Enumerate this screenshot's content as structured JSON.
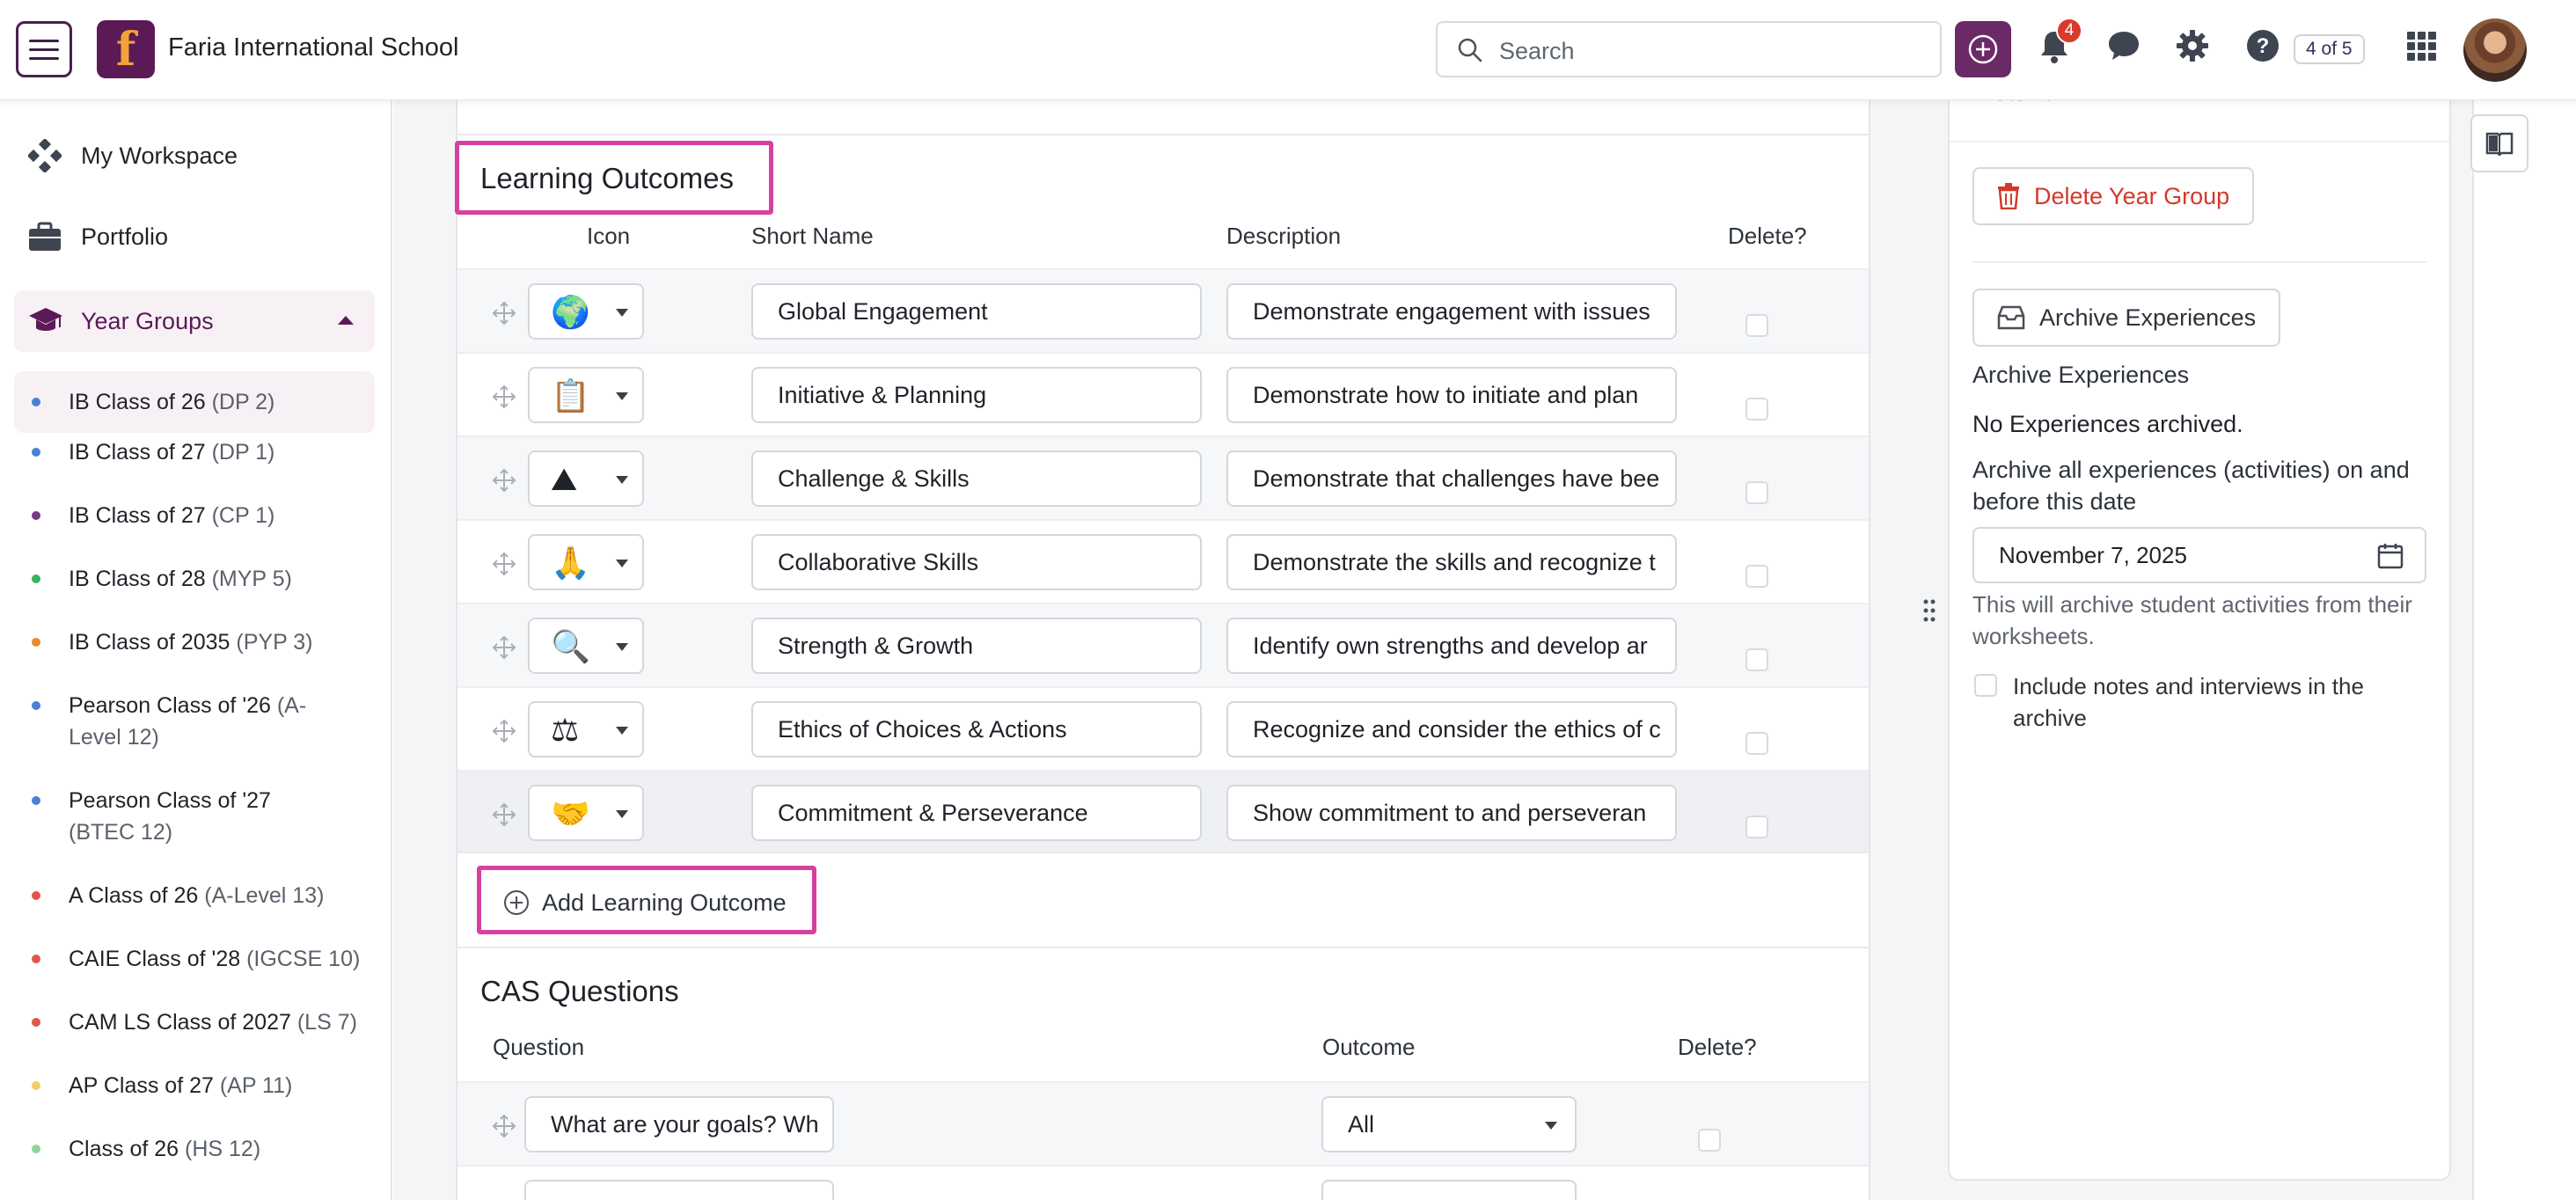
{
  "app": {
    "school_name": "Faria International School",
    "logo_letter": "f",
    "search_placeholder": "Search",
    "notification_count": "4",
    "page_count": "4 of 5",
    "colors": {
      "brand": "#5b1a55",
      "accent": "#d6409f",
      "danger": "#d93a2b"
    }
  },
  "sidebar": {
    "workspace": "My Workspace",
    "portfolio": "Portfolio",
    "year_groups_label": "Year Groups",
    "items": [
      {
        "name": "IB Class of 26",
        "tag": "(DP 2)",
        "color": "#4a7fd6",
        "active": true
      },
      {
        "name": "IB Class of 27",
        "tag": "(DP 1)",
        "color": "#4a7fd6"
      },
      {
        "name": "IB Class of 27",
        "tag": "(CP 1)",
        "color": "#7a3a86"
      },
      {
        "name": "IB Class of 28",
        "tag": "(MYP 5)",
        "color": "#3bb35c"
      },
      {
        "name": "IB Class of 2035",
        "tag": "(PYP 3)",
        "color": "#e98a2c"
      },
      {
        "name": "Pearson Class of '26",
        "tag": "(A-Level 12)",
        "color": "#4a7fd6"
      },
      {
        "name": "Pearson Class of '27",
        "tag": "(BTEC 12)",
        "color": "#4a7fd6"
      },
      {
        "name": "A Class of 26",
        "tag": "(A-Level 13)",
        "color": "#e0574a"
      },
      {
        "name": "CAIE Class of '28",
        "tag": "(IGCSE 10)",
        "color": "#e0574a"
      },
      {
        "name": "CAM LS Class of 2027",
        "tag": "(LS 7)",
        "color": "#e0574a"
      },
      {
        "name": "AP Class of 27",
        "tag": "(AP 11)",
        "color": "#f0cf6a"
      },
      {
        "name": "Class of 26",
        "tag": "(HS 12)",
        "color": "#8fd49a"
      }
    ]
  },
  "learning_outcomes": {
    "title": "Learning Outcomes",
    "col_icon": "Icon",
    "col_short_name": "Short Name",
    "col_description": "Description",
    "col_delete": "Delete?",
    "rows": [
      {
        "icon": "🌍",
        "icon_name": "globe-icon",
        "short_name": "Global Engagement",
        "description": "Demonstrate engagement with issues"
      },
      {
        "icon": "📋",
        "icon_name": "planning-icon",
        "short_name": "Initiative & Planning",
        "description": "Demonstrate how to initiate and plan"
      },
      {
        "icon": "⛰",
        "icon_name": "mountain-icon",
        "short_name": "Challenge & Skills",
        "description": "Demonstrate that challenges have bee"
      },
      {
        "icon": "🙏",
        "icon_name": "hands-icon",
        "short_name": "Collaborative Skills",
        "description": "Demonstrate the skills and recognize t"
      },
      {
        "icon": "🔍",
        "icon_name": "magnifier-icon",
        "short_name": "Strength & Growth",
        "description": "Identify own strengths and develop ar"
      },
      {
        "icon": "⚖",
        "icon_name": "balance-icon",
        "short_name": "Ethics of Choices & Actions",
        "description": "Recognize and consider the ethics of c"
      },
      {
        "icon": "🤝",
        "icon_name": "handshake-icon",
        "short_name": "Commitment & Perseverance",
        "description": "Show commitment to and perseveran"
      }
    ],
    "add_label": "Add Learning Outcome"
  },
  "cas_questions": {
    "title": "CAS Questions",
    "col_question": "Question",
    "col_outcome": "Outcome",
    "col_delete": "Delete?",
    "rows": [
      {
        "question": "What are your goals? Wh",
        "outcome": "All"
      },
      {
        "question": "",
        "outcome": ""
      }
    ]
  },
  "details": {
    "title": "Details",
    "delete_label": "Delete Year Group",
    "archive_button": "Archive Experiences",
    "archive_heading": "Archive Experiences",
    "archive_status": "No Experiences archived.",
    "archive_before_label": "Archive all experiences (activities) on and before this date",
    "archive_date": "November 7, 2025",
    "archive_help": "This will archive student activities from their worksheets.",
    "include_notes_label": "Include notes and interviews in the archive"
  }
}
